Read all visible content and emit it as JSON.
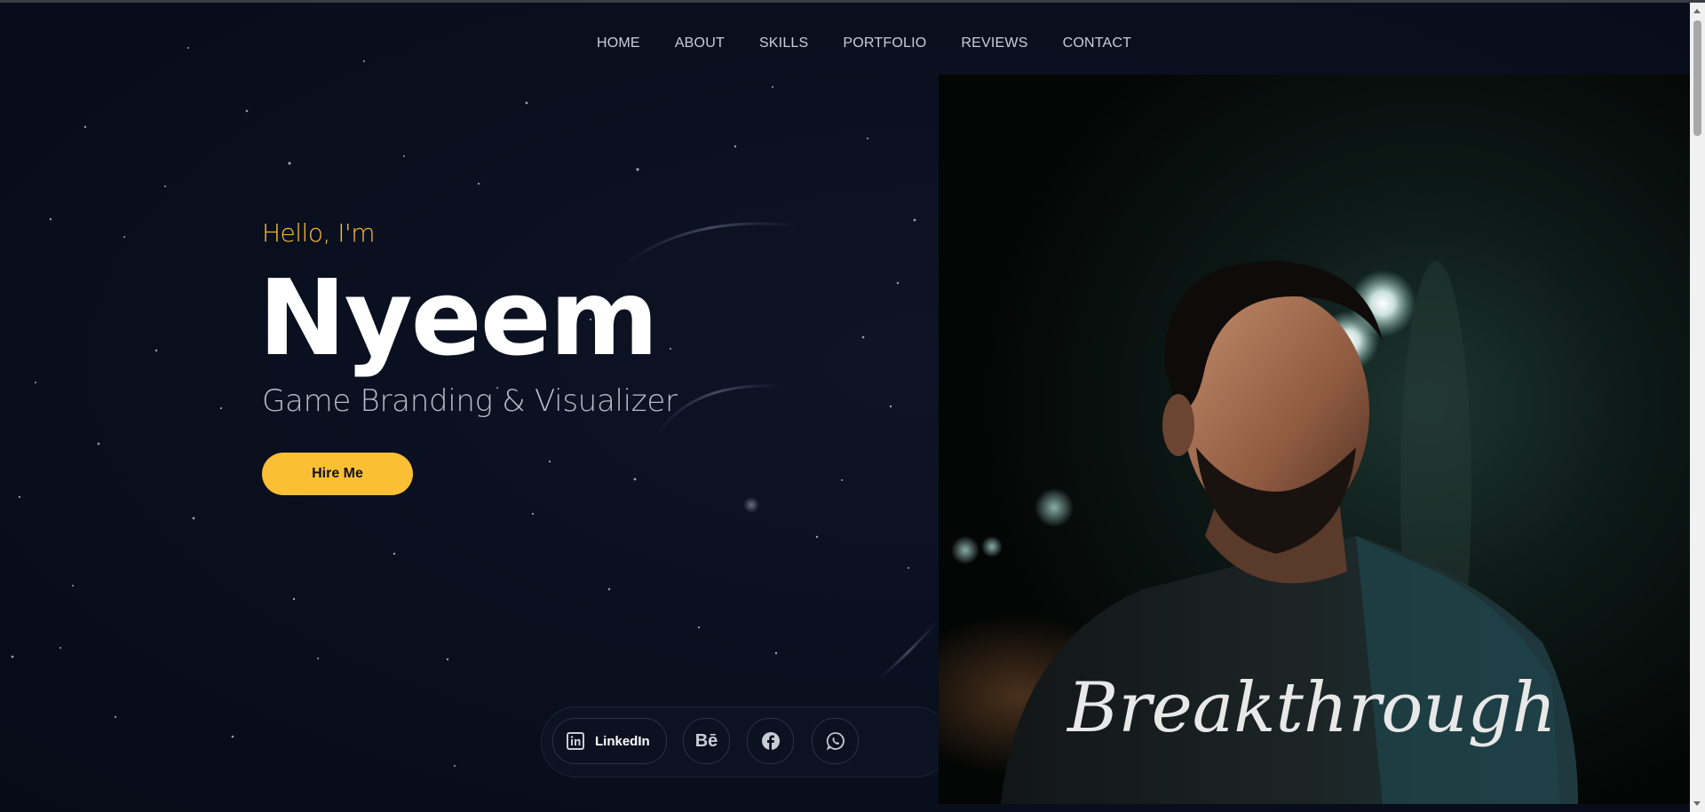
{
  "nav": {
    "items": [
      {
        "label": "HOME"
      },
      {
        "label": "ABOUT"
      },
      {
        "label": "SKILLS"
      },
      {
        "label": "PORTFOLIO"
      },
      {
        "label": "REVIEWS"
      },
      {
        "label": "CONTACT"
      }
    ]
  },
  "hero": {
    "greeting": "Hello, I'm",
    "name": "Nyeem",
    "role": "Game Branding & Visualizer",
    "cta_label": "Hire Me"
  },
  "portrait": {
    "shirt_text": "Breakthrough"
  },
  "social": {
    "linkedin_label": "LinkedIn",
    "behance_glyph": "Bē",
    "icons": [
      "linkedin-icon",
      "behance-icon",
      "facebook-icon",
      "whatsapp-icon"
    ]
  },
  "colors": {
    "background": "#0a0f1e",
    "accent": "#fbbf36",
    "text_primary": "#ffffff",
    "text_muted": "#b8bec9"
  }
}
